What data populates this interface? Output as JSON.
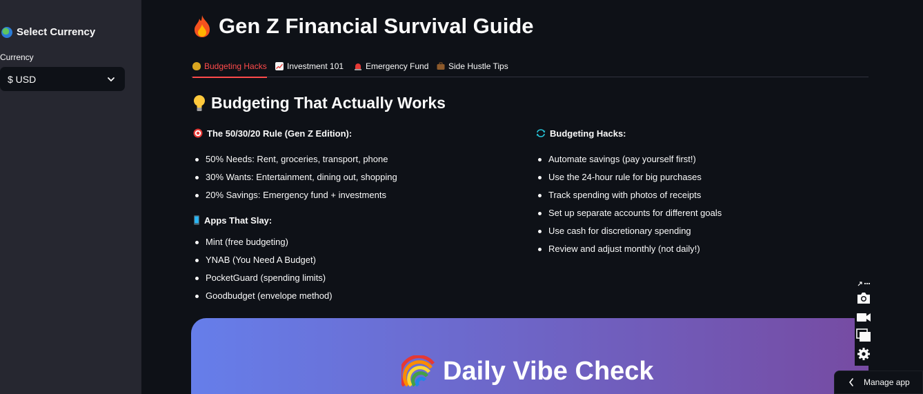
{
  "sidebar": {
    "title": "Select Currency",
    "currency_label": "Currency",
    "currency_value": "$ USD"
  },
  "main": {
    "title": "Gen Z Financial Survival Guide",
    "tabs": [
      {
        "label": "Budgeting Hacks",
        "icon": "money-bag-icon",
        "active": true
      },
      {
        "label": "Investment 101",
        "icon": "chart-up-icon",
        "active": false
      },
      {
        "label": "Emergency Fund",
        "icon": "siren-icon",
        "active": false
      },
      {
        "label": "Side Hustle Tips",
        "icon": "briefcase-icon",
        "active": false
      }
    ],
    "section_title": "Budgeting That Actually Works",
    "left": {
      "rule_heading": "The 50/30/20 Rule (Gen Z Edition):",
      "rule_items": [
        "50% Needs: Rent, groceries, transport, phone",
        "30% Wants: Entertainment, dining out, shopping",
        "20% Savings: Emergency fund + investments"
      ],
      "apps_heading": "Apps That Slay:",
      "apps_items": [
        "Mint (free budgeting)",
        "YNAB (You Need A Budget)",
        "PocketGuard (spending limits)",
        "Goodbudget (envelope method)"
      ]
    },
    "right": {
      "hacks_heading": "Budgeting Hacks:",
      "hacks_items": [
        "Automate savings (pay yourself first!)",
        "Use the 24-hour rule for big purchases",
        "Track spending with photos of receipts",
        "Set up separate accounts for different goals",
        "Use cash for discretionary spending",
        "Review and adjust monthly (not daily!)"
      ]
    },
    "vibe_title": "Daily Vibe Check"
  },
  "footer": {
    "manage_app": "Manage app"
  },
  "colors": {
    "background": "#0e1117",
    "sidebar": "#262730",
    "accent": "#ff4b4b",
    "gradient_start": "#667eea",
    "gradient_end": "#764ba2"
  }
}
